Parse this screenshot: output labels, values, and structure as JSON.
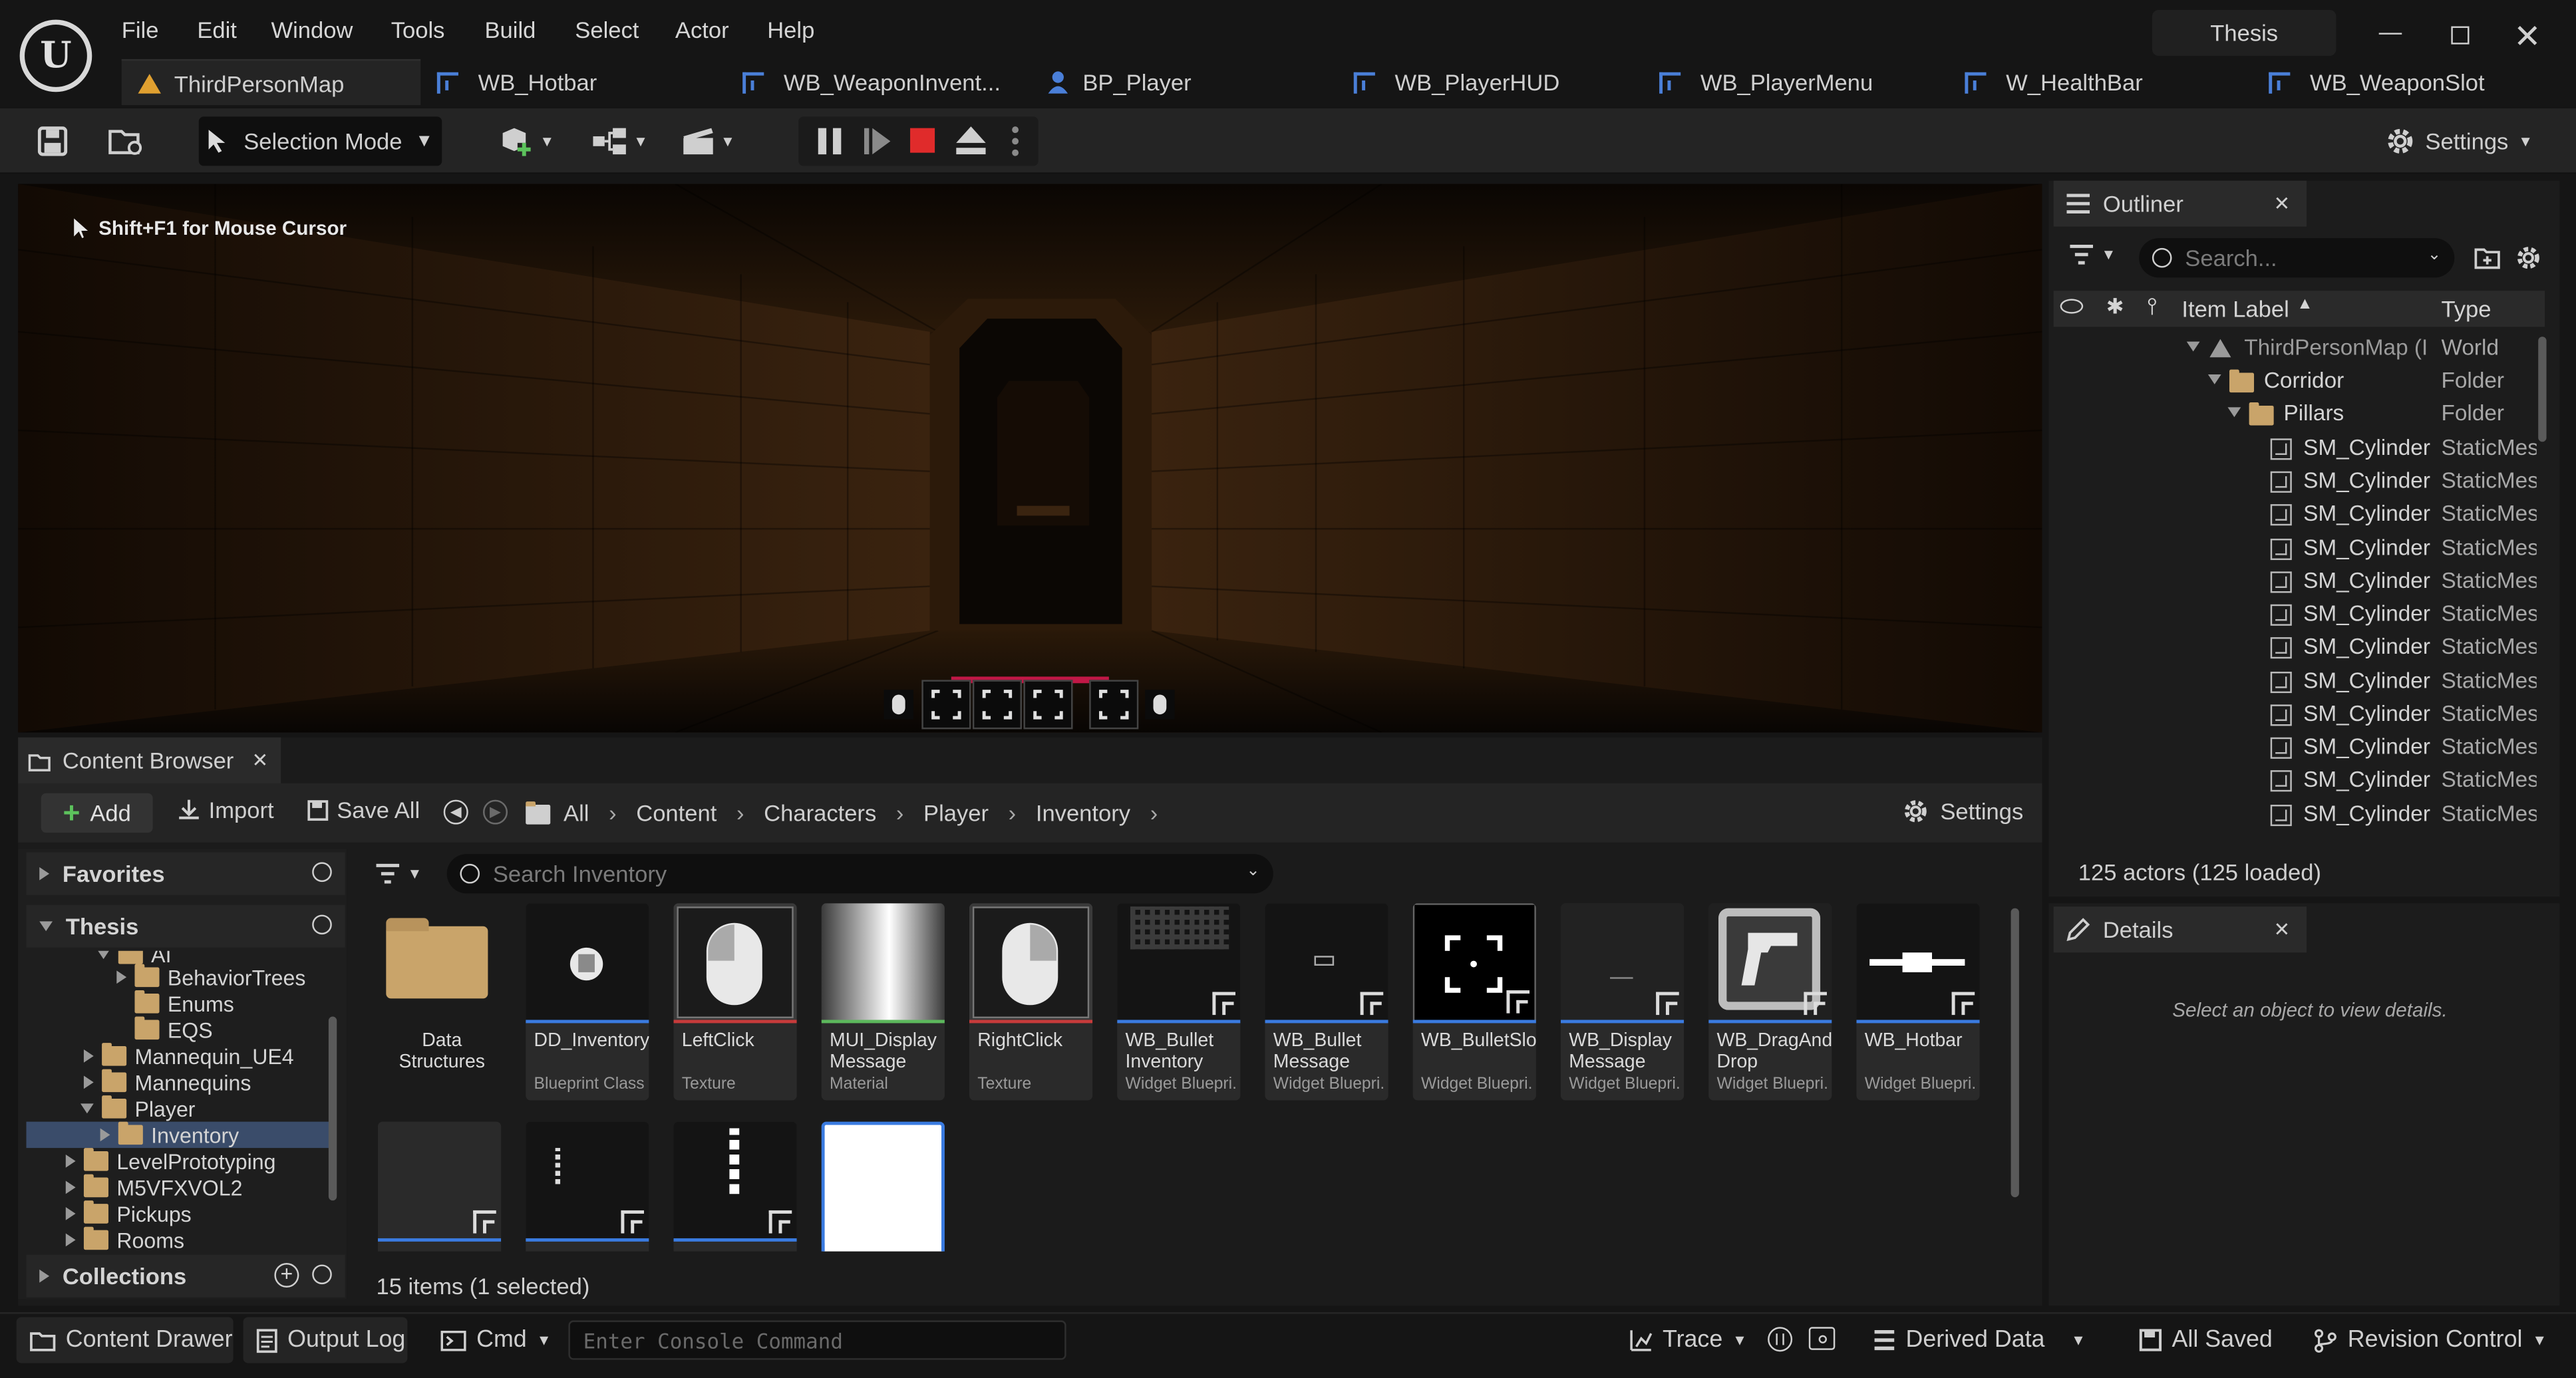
{
  "titlebar": {
    "project_name": "Thesis",
    "menu": [
      "File",
      "Edit",
      "Window",
      "Tools",
      "Build",
      "Select",
      "Actor",
      "Help"
    ],
    "tabs": [
      "ThirdPersonMap",
      "WB_Hotbar",
      "WB_WeaponInvent...",
      "BP_Player",
      "WB_PlayerHUD",
      "WB_PlayerMenu",
      "W_HealthBar",
      "WB_WeaponSlot"
    ]
  },
  "toolbar": {
    "selection_mode": "Selection Mode",
    "settings": "Settings"
  },
  "viewport": {
    "hint": "Shift+F1 for Mouse Cursor"
  },
  "content_browser": {
    "tab_title": "Content Browser",
    "add": "Add",
    "import": "Import",
    "save_all": "Save All",
    "breadcrumb": [
      "All",
      "Content",
      "Characters",
      "Player",
      "Inventory"
    ],
    "settings": "Settings",
    "favorites": "Favorites",
    "root": "Thesis",
    "search_placeholder": "Search Inventory",
    "collections": "Collections",
    "tree": [
      {
        "label": "AI"
      },
      {
        "label": "BehaviorTrees"
      },
      {
        "label": "Enums"
      },
      {
        "label": "EQS"
      },
      {
        "label": "Mannequin_UE4"
      },
      {
        "label": "Mannequins"
      },
      {
        "label": "Player"
      },
      {
        "label": "Inventory"
      },
      {
        "label": "LevelPrototyping"
      },
      {
        "label": "M5VFXVOL2"
      },
      {
        "label": "Pickups"
      },
      {
        "label": "Rooms"
      }
    ],
    "assets": [
      {
        "name": "Data\nStructures",
        "type": ""
      },
      {
        "name": "DD_Inventory",
        "type": "Blueprint Class"
      },
      {
        "name": "LeftClick",
        "type": "Texture"
      },
      {
        "name": "MUI_Display\nMessage",
        "type": "Material"
      },
      {
        "name": "RightClick",
        "type": "Texture"
      },
      {
        "name": "WB_Bullet\nInventory",
        "type": "Widget Bluepri..."
      },
      {
        "name": "WB_Bullet\nMessage",
        "type": "Widget Bluepri..."
      },
      {
        "name": "WB_BulletSlot",
        "type": "Widget Bluepri..."
      },
      {
        "name": "WB_Display\nMessage",
        "type": "Widget Bluepri..."
      },
      {
        "name": "WB_DragAnd\nDrop",
        "type": "Widget Bluepri..."
      },
      {
        "name": "WB_Hotbar",
        "type": "Widget Bluepri..."
      }
    ],
    "items_status": "15 items (1 selected)"
  },
  "outliner": {
    "title": "Outliner",
    "search_placeholder": "Search...",
    "col_label": "Item Label",
    "col_type": "Type",
    "rows": [
      {
        "label": "ThirdPersonMap (I",
        "type": "World"
      },
      {
        "label": "Corridor",
        "type": "Folder"
      },
      {
        "label": "Pillars",
        "type": "Folder"
      },
      {
        "label": "SM_Cylinder",
        "type": "StaticMes"
      },
      {
        "label": "SM_Cylinder",
        "type": "StaticMes"
      },
      {
        "label": "SM_Cylinder",
        "type": "StaticMes"
      },
      {
        "label": "SM_Cylinder",
        "type": "StaticMes"
      },
      {
        "label": "SM_Cylinder",
        "type": "StaticMes"
      },
      {
        "label": "SM_Cylinder",
        "type": "StaticMes"
      },
      {
        "label": "SM_Cylinder",
        "type": "StaticMes"
      },
      {
        "label": "SM_Cylinder",
        "type": "StaticMes"
      },
      {
        "label": "SM_Cylinder",
        "type": "StaticMes"
      },
      {
        "label": "SM_Cylinder",
        "type": "StaticMes"
      },
      {
        "label": "SM_Cylinder",
        "type": "StaticMes"
      },
      {
        "label": "SM_Cylinder",
        "type": "StaticMes"
      }
    ],
    "actors_count": "125 actors (125 loaded)"
  },
  "details": {
    "title": "Details",
    "empty": "Select an object to view details."
  },
  "statusbar": {
    "content_drawer": "Content Drawer",
    "output_log": "Output Log",
    "cmd": "Cmd",
    "console_placeholder": "Enter Console Command",
    "trace": "Trace",
    "derived_data": "Derived Data",
    "all_saved": "All Saved",
    "revision_control": "Revision Control"
  },
  "colors": {
    "accent_blue": "#3a7be0",
    "texture_red": "#c73b3b",
    "material_green": "#5cb85c",
    "folder": "#c9a46a",
    "stop_red": "#e02b2b"
  }
}
